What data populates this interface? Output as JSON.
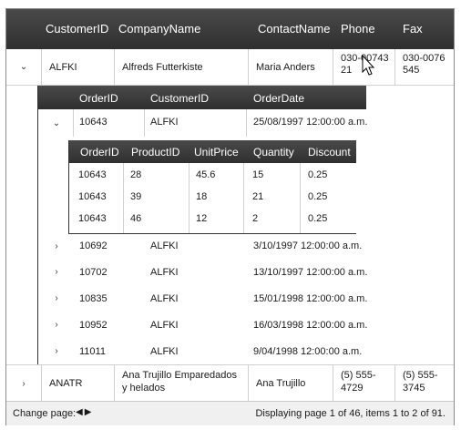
{
  "columns": {
    "customer_id": "CustomerID",
    "company_name": "CompanyName",
    "contact_name": "ContactName",
    "phone": "Phone",
    "fax": "Fax"
  },
  "customers": [
    {
      "id": "ALFKI",
      "company": "Alfreds Futterkiste",
      "contact": "Maria Anders",
      "phone": "030-0074321",
      "fax": "030-0076545",
      "expanded": true
    },
    {
      "id": "ANATR",
      "company": "Ana Trujillo Emparedados y helados",
      "contact": "Ana Trujillo",
      "phone": "(5) 555-4729",
      "fax": "(5) 555-3745",
      "expanded": false
    }
  ],
  "order_columns": {
    "order_id": "OrderID",
    "customer_id": "CustomerID",
    "order_date": "OrderDate"
  },
  "orders": [
    {
      "id": "10643",
      "customer": "ALFKI",
      "date": "25/08/1997 12:00:00 a.m.",
      "expanded": true
    },
    {
      "id": "10692",
      "customer": "ALFKI",
      "date": "3/10/1997 12:00:00 a.m."
    },
    {
      "id": "10702",
      "customer": "ALFKI",
      "date": "13/10/1997 12:00:00 a.m."
    },
    {
      "id": "10835",
      "customer": "ALFKI",
      "date": "15/01/1998 12:00:00 a.m."
    },
    {
      "id": "10952",
      "customer": "ALFKI",
      "date": "16/03/1998 12:00:00 a.m."
    },
    {
      "id": "11011",
      "customer": "ALFKI",
      "date": "9/04/1998 12:00:00 a.m."
    }
  ],
  "detail_columns": {
    "order_id": "OrderID",
    "product_id": "ProductID",
    "unit_price": "UnitPrice",
    "quantity": "Quantity",
    "discount": "Discount"
  },
  "details": [
    {
      "order_id": "10643",
      "product_id": "28",
      "unit_price": "45.6",
      "quantity": "15",
      "discount": "0.25"
    },
    {
      "order_id": "10643",
      "product_id": "39",
      "unit_price": "18",
      "quantity": "21",
      "discount": "0.25"
    },
    {
      "order_id": "10643",
      "product_id": "46",
      "unit_price": "12",
      "quantity": "2",
      "discount": "0.25"
    }
  ],
  "footer": {
    "change_page": "Change page:",
    "status": "Displaying page 1 of 46, items 1 to 2 of 91."
  },
  "icons": {
    "expanded": "chevron-down-icon",
    "collapsed": "chevron-right-icon",
    "prev": "triangle-left-icon",
    "next": "triangle-right-icon"
  }
}
